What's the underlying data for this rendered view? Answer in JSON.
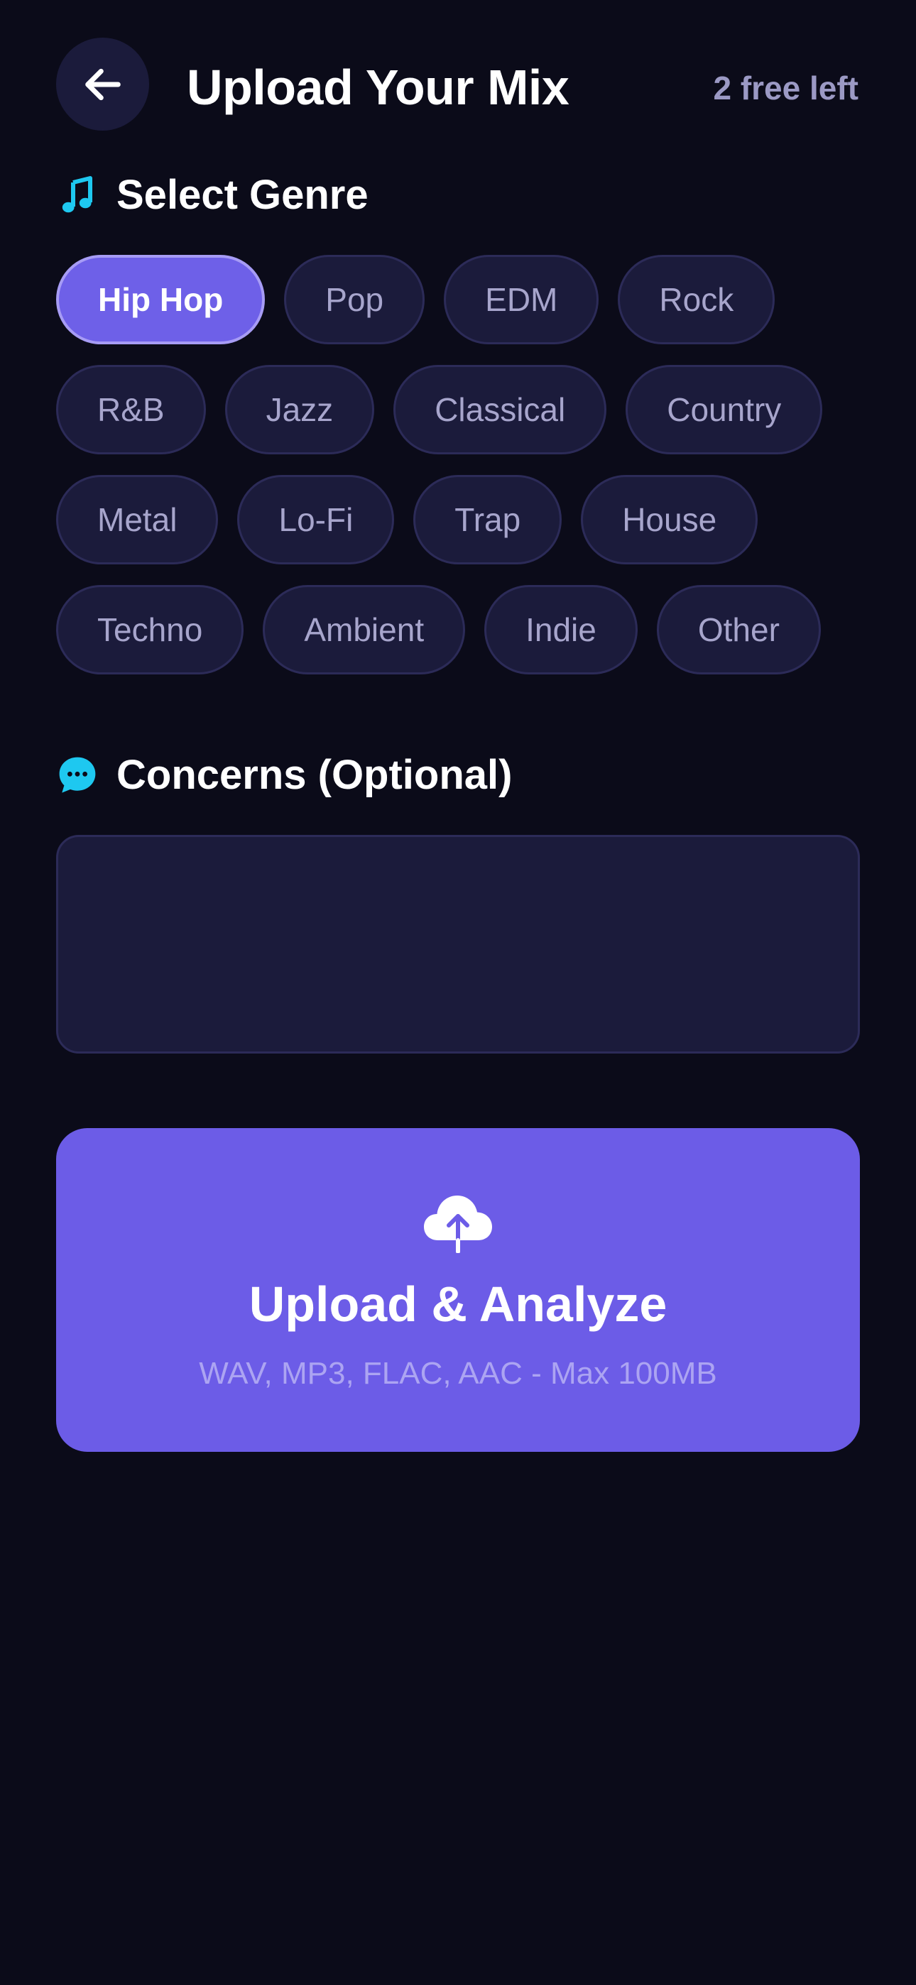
{
  "header": {
    "title": "Upload Your Mix",
    "free_left": "2 free left",
    "back_icon": "arrow-left-icon"
  },
  "genre_section": {
    "icon": "music-note-icon",
    "icon_color": "#1ec8f0",
    "label": "Select Genre",
    "selected": "Hip Hop",
    "rows": [
      [
        "Hip Hop",
        "Pop",
        "EDM",
        "Rock"
      ],
      [
        "R&B",
        "Jazz",
        "Classical",
        "Country"
      ],
      [
        "Metal",
        "Lo-Fi",
        "Trap",
        "House"
      ],
      [
        "Techno",
        "Ambient",
        "Indie",
        "Other"
      ]
    ]
  },
  "concerns_section": {
    "icon": "chat-bubble-icon",
    "icon_color": "#1ec8f0",
    "label": "Concerns (Optional)",
    "value": ""
  },
  "upload": {
    "icon": "cloud-upload-icon",
    "title": "Upload & Analyze",
    "subtitle": "WAV, MP3, FLAC, AAC - Max 100MB"
  },
  "colors": {
    "background": "#0b0b19",
    "surface": "#1b1b3b",
    "accent": "#6c5ce7",
    "muted_text": "#9b99c4"
  }
}
